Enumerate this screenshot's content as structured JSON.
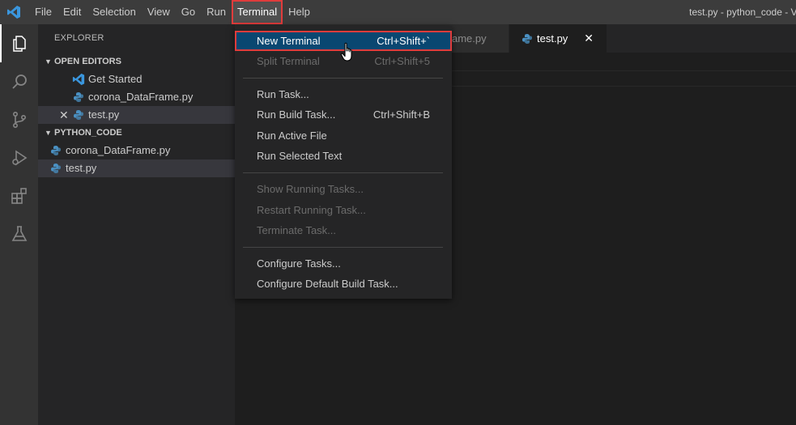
{
  "menubar": {
    "items": [
      "File",
      "Edit",
      "Selection",
      "View",
      "Go",
      "Run",
      "Terminal",
      "Help"
    ],
    "window_title": "test.py - python_code - Vi"
  },
  "sidebar": {
    "title": "EXPLORER",
    "open_editors": {
      "header": "OPEN EDITORS",
      "items": [
        "Get Started",
        "corona_DataFrame.py",
        "test.py"
      ]
    },
    "folder": {
      "header": "PYTHON_CODE",
      "items": [
        "corona_DataFrame.py",
        "test.py"
      ]
    }
  },
  "tabs": {
    "partial_tab": "ame.py",
    "active_tab": "test.py"
  },
  "terminal_menu": {
    "items": [
      {
        "label": "New Terminal",
        "shortcut": "Ctrl+Shift+`"
      },
      {
        "label": "Split Terminal",
        "shortcut": "Ctrl+Shift+5"
      },
      {
        "label": "Run Task...",
        "shortcut": ""
      },
      {
        "label": "Run Build Task...",
        "shortcut": "Ctrl+Shift+B"
      },
      {
        "label": "Run Active File",
        "shortcut": ""
      },
      {
        "label": "Run Selected Text",
        "shortcut": ""
      },
      {
        "label": "Show Running Tasks...",
        "shortcut": ""
      },
      {
        "label": "Restart Running Task...",
        "shortcut": ""
      },
      {
        "label": "Terminate Task...",
        "shortcut": ""
      },
      {
        "label": "Configure Tasks...",
        "shortcut": ""
      },
      {
        "label": "Configure Default Build Task...",
        "shortcut": ""
      }
    ]
  },
  "colors": {
    "highlight": "#094771",
    "annotation_red": "#e03c3c",
    "vscode_blue": "#3a96dd"
  }
}
